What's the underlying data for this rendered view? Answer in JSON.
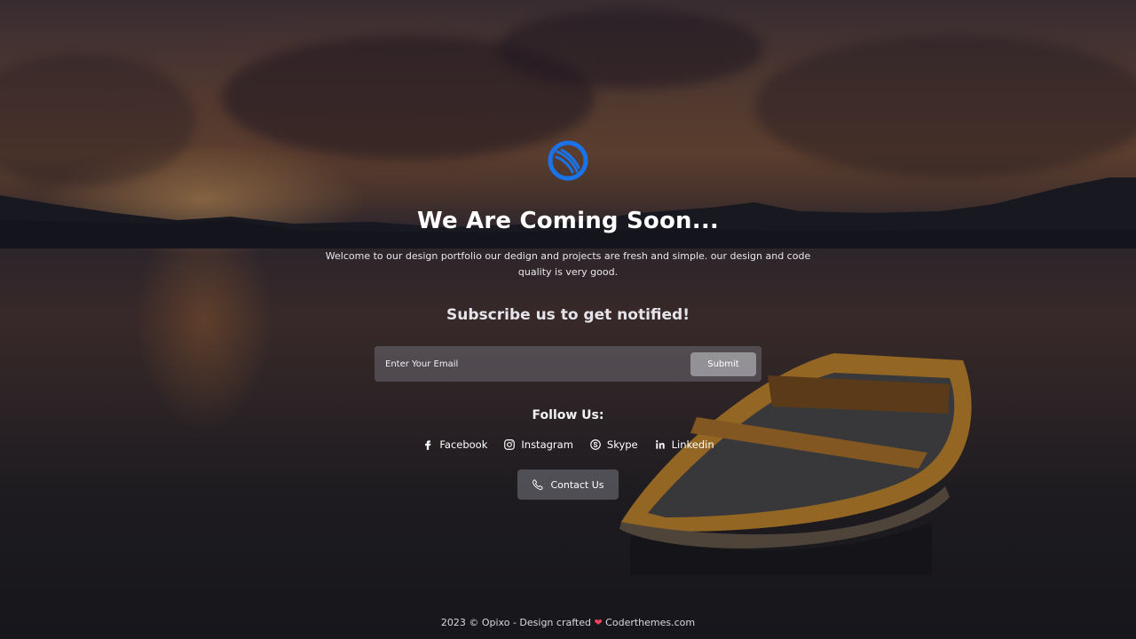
{
  "header": {
    "logo_icon": "brand-logo-icon",
    "title": "We Are Coming Soon...",
    "description": "Welcome to our design portfolio our dedign and projects are fresh and simple. our design and code quality is very good."
  },
  "subscribe": {
    "title": "Subscribe us to get notified!",
    "email_placeholder": "Enter Your Email",
    "submit_label": "Submit"
  },
  "follow": {
    "title": "Follow Us:",
    "links": [
      {
        "label": "Facebook",
        "icon": "facebook-icon"
      },
      {
        "label": "Instagram",
        "icon": "instagram-icon"
      },
      {
        "label": "Skype",
        "icon": "skype-icon"
      },
      {
        "label": "Linkedin",
        "icon": "linkedin-icon"
      }
    ]
  },
  "contact": {
    "label": "Contact Us",
    "icon": "phone-icon"
  },
  "footer": {
    "prefix": "2023 © Opixo - Design crafted",
    "heart_icon": "heart-icon",
    "suffix": "Coderthemes.com"
  },
  "colors": {
    "logo": "#1a73e8",
    "heart": "#f0445a"
  }
}
